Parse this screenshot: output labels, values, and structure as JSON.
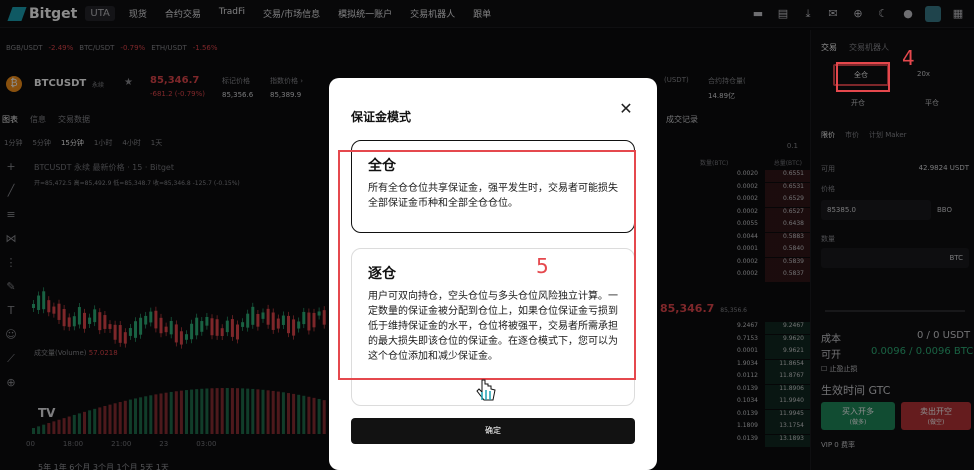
{
  "header": {
    "brand": "Bitget",
    "account_tag": "UTA",
    "nav": [
      "现货",
      "合约交易",
      "TradFi",
      "交易/市场信息",
      "模拟统一账户",
      "交易机器人",
      "跟单"
    ]
  },
  "ticker_strip": [
    {
      "pair": "BGB/USDT",
      "change": "-2.49%"
    },
    {
      "pair": "BTC/USDT",
      "change": "-0.79%"
    },
    {
      "pair": "ETH/USDT",
      "change": "-1.56%"
    }
  ],
  "symbol": {
    "name": "BTCUSDT",
    "tag": "永续",
    "price": "85,346.7",
    "change": "-681.2 (-0.79%)",
    "stats": [
      {
        "label": "标记价格",
        "value": "85,356.6"
      },
      {
        "label": "指数价格 ›",
        "value": "85,389.9"
      }
    ],
    "stat_right": {
      "label": "合约持仓量(",
      "value": "14.89亿"
    },
    "stat_right2": "(USDT)"
  },
  "chart": {
    "tabs": [
      "图表",
      "信息",
      "交易数据"
    ],
    "timeframes": [
      "1分钟",
      "5分钟",
      "15分钟",
      "1小时",
      "4小时",
      "1天"
    ],
    "title": "BTCUSDT 永续 最新价格 · 15 · Bitget",
    "ohlc": "开=85,472.5 高=85,492.9 低=85,348.7 收=85,346.8 -125.7 (-0.15%)",
    "volume_label": "成交量(Volume)",
    "volume_value": "57.0218",
    "xaxis": [
      "00",
      "18:00",
      "21:00",
      "23",
      "03:00"
    ],
    "range_buttons": "5年 1年 6个月 3个月 1个月 5天 1天"
  },
  "book": {
    "tab": "成交记录",
    "precision": "0.1",
    "col_qty": "数量(BTC)",
    "col_total": "总量(BTC)",
    "asks": [
      [
        "0.0020",
        "0.6551"
      ],
      [
        "0.0002",
        "0.6531"
      ],
      [
        "0.0002",
        "0.6529"
      ],
      [
        "0.0002",
        "0.6527"
      ],
      [
        "0.0055",
        "0.6438"
      ],
      [
        "0.0044",
        "0.5883"
      ],
      [
        "0.0001",
        "0.5840"
      ],
      [
        "0.0002",
        "0.5839"
      ],
      [
        "0.0002",
        "0.5837"
      ]
    ],
    "mid_price": "85,346.7",
    "mid_mark": "85,356.6",
    "bids": [
      [
        "9.2467",
        "9.2467"
      ],
      [
        "0.7153",
        "9.9620"
      ],
      [
        "0.0001",
        "9.9621"
      ],
      [
        "1.9034",
        "11.8654"
      ],
      [
        "0.0112",
        "11.8767"
      ],
      [
        "0.0139",
        "11.8906"
      ],
      [
        "0.1034",
        "11.9940"
      ],
      [
        "0.0139",
        "11.9945"
      ],
      [
        "1.1809",
        "13.1754"
      ],
      [
        "0.0139",
        "13.1893"
      ]
    ]
  },
  "order": {
    "tabs": [
      "交易",
      "交易机器人"
    ],
    "margin_mode": "全仓",
    "leverage": "20x",
    "open_label": "开仓",
    "close_label": "平仓",
    "types": [
      "限价",
      "市价",
      "计划 Maker"
    ],
    "available_label": "可用",
    "available_value": "42.9824 USDT",
    "price_label": "价格",
    "price_value": "85385.0",
    "price_mode": "BBO",
    "qty_label": "数量",
    "qty_unit": "BTC",
    "cost_label": "成本",
    "cost_value": "0 / 0 USDT",
    "open_able_label": "可开",
    "open_able_value": "0.0096 / 0.0096 BTC",
    "tpsl_label": "止盈止损",
    "tif": "生效时间 GTC",
    "long_label": "买入开多",
    "long_sub": "(做多)",
    "short_label": "卖出开空",
    "short_sub": "(做空)",
    "vip": "VIP 0 费率"
  },
  "modal": {
    "title": "保证金模式",
    "cross": {
      "title": "全仓",
      "desc": "所有全仓仓位共享保证金，强平发生时，交易者可能损失全部保证金币种和全部全仓仓位。"
    },
    "isolated": {
      "title": "逐仓",
      "desc": "用户可双向持仓，空头仓位与多头仓位风险独立计算。一定数量的保证金被分配到仓位上，如果仓位保证金亏损到低于维持保证金的水平，仓位将被强平，交易者所需承担的最大损失即该仓位的保证金。在逐仓模式下，您可以为这个仓位添加和减少保证金。"
    },
    "confirm": "确定"
  },
  "annotations": {
    "step4": "4",
    "step5": "5",
    "color": "#e5484d"
  }
}
